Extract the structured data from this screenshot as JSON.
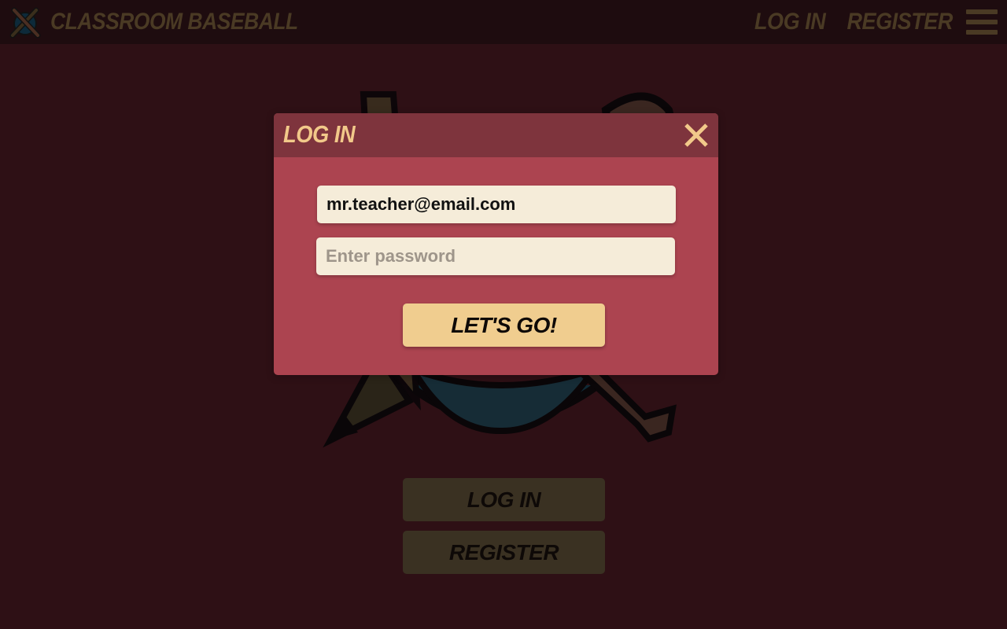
{
  "navbar": {
    "brand_name": "Classroom Baseball",
    "links": [
      "Log In",
      "Register"
    ]
  },
  "hero": {
    "logo_icon": "pencil-bat-ball-logo"
  },
  "background_buttons": {
    "login_label": "Log In",
    "register_label": "Register"
  },
  "modal": {
    "title": "Log In",
    "email_value": "mr.teacher@email.com",
    "password_placeholder": "Enter password",
    "submit_label": "Let's Go!"
  },
  "colors": {
    "page_bg": "#2e1015",
    "navbar_bg": "#1e0c0f",
    "modal_body": "#ac4450",
    "modal_header": "#7e343d",
    "accent": "#f0cd8f",
    "muted_text": "#4a3a24"
  }
}
